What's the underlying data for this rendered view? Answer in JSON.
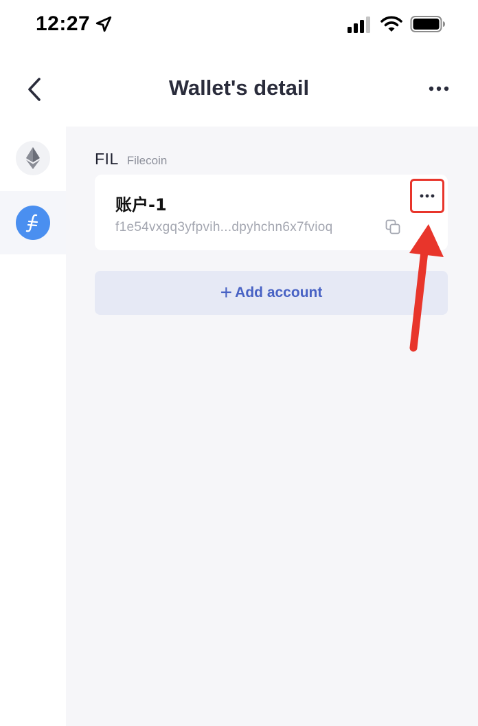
{
  "status_bar": {
    "time": "12:27",
    "icons": [
      "location-arrow-icon",
      "signal-icon",
      "wifi-icon",
      "battery-icon"
    ]
  },
  "header": {
    "title": "Wallet's detail",
    "back_icon": "chevron-left-icon",
    "more_icon": "more-horizontal-icon"
  },
  "chain_rail": {
    "items": [
      {
        "icon": "ethereum-icon",
        "selected": false
      },
      {
        "icon": "filecoin-icon",
        "selected": true
      }
    ]
  },
  "chain_section": {
    "symbol": "FIL",
    "name": "Filecoin"
  },
  "account": {
    "name": "账户-1",
    "address": "f1e54vxgq3yfpvih...dpyhchn6x7fvioq",
    "copy_icon": "copy-icon",
    "more_icon": "more-horizontal-icon"
  },
  "add_account": {
    "plus": "+",
    "label": "Add account"
  },
  "colors": {
    "accent": "#4862c4",
    "filecoin": "#4a8ff0",
    "highlight": "#e8352b",
    "content_bg": "#f6f6f9"
  }
}
